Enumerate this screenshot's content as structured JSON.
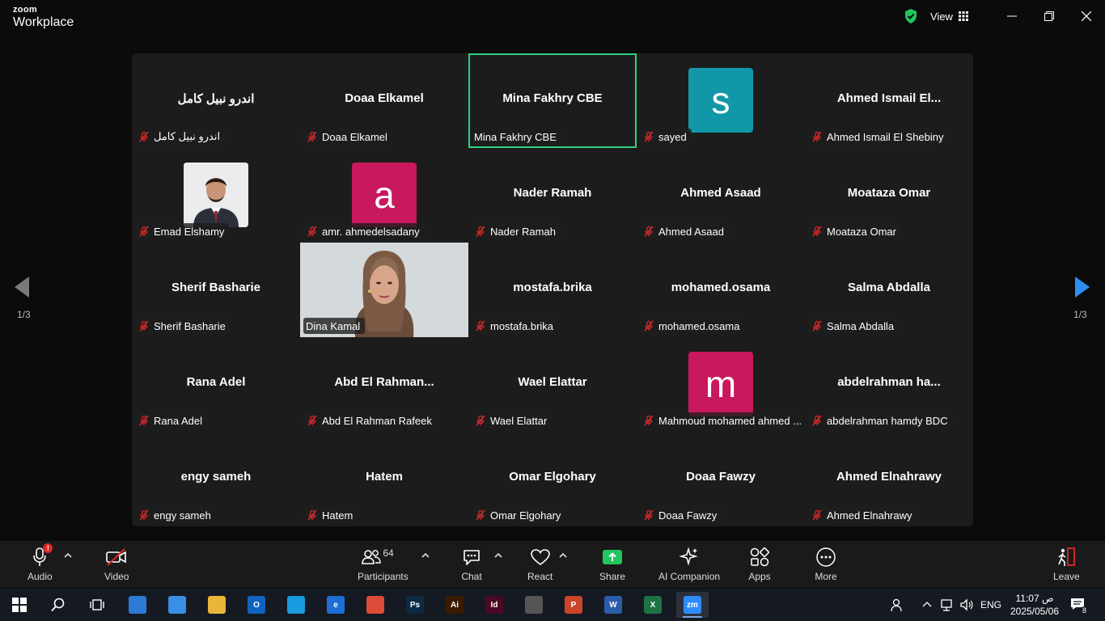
{
  "window": {
    "brand_small": "zoom",
    "brand_big": "Workplace",
    "view_label": "View"
  },
  "navigation": {
    "left_page": "1/3",
    "right_page": "1/3"
  },
  "tiles": [
    {
      "big": "اندرو نبيل كامل",
      "label": "اندرو نبيل كامل",
      "muted": true
    },
    {
      "big": "Doaa Elkamel",
      "label": "Doaa Elkamel",
      "muted": true
    },
    {
      "big": "Mina Fakhry CBE",
      "label": "Mina Fakhry CBE",
      "muted": false,
      "active": true
    },
    {
      "avatar": "s",
      "avatar_color": "#1197a7",
      "label": "sayed",
      "muted": true
    },
    {
      "big": "Ahmed Ismail El...",
      "label": "Ahmed Ismail El Shebiny",
      "muted": true
    },
    {
      "photo": "portrait",
      "label": "Emad Elshamy",
      "muted": true
    },
    {
      "avatar": "a",
      "avatar_color": "#c8185e",
      "label": "amr. ahmedelsadany",
      "muted": true
    },
    {
      "big": "Nader Ramah",
      "label": "Nader Ramah",
      "muted": true
    },
    {
      "big": "Ahmed Asaad",
      "label": "Ahmed Asaad",
      "muted": true
    },
    {
      "big": "Moataza Omar",
      "label": "Moataza Omar",
      "muted": true
    },
    {
      "big": "Sherif Basharie",
      "label": "Sherif Basharie",
      "muted": true
    },
    {
      "video": true,
      "label": "Dina Kamal",
      "muted": false
    },
    {
      "big": "mostafa.brika",
      "label": "mostafa.brika",
      "muted": true
    },
    {
      "big": "mohamed.osama",
      "label": "mohamed.osama",
      "muted": true
    },
    {
      "big": "Salma Abdalla",
      "label": "Salma Abdalla",
      "muted": true
    },
    {
      "big": "Rana Adel",
      "label": "Rana Adel",
      "muted": true
    },
    {
      "big": "Abd El Rahman...",
      "label": "Abd El Rahman Rafeek",
      "muted": true
    },
    {
      "big": "Wael Elattar",
      "label": "Wael Elattar",
      "muted": true
    },
    {
      "avatar": "m",
      "avatar_color": "#c8185e",
      "label": "Mahmoud mohamed ahmed ...",
      "muted": true
    },
    {
      "big": "abdelrahman  ha...",
      "label": "abdelrahman hamdy BDC",
      "muted": true
    },
    {
      "big": "engy sameh",
      "label": "engy sameh",
      "muted": true
    },
    {
      "big": "Hatem",
      "label": "Hatem",
      "muted": true
    },
    {
      "big": "Omar Elgohary",
      "label": "Omar Elgohary",
      "muted": true
    },
    {
      "big": "Doaa Fawzy",
      "label": "Doaa Fawzy",
      "muted": true
    },
    {
      "big": "Ahmed Elnahrawy",
      "label": "Ahmed Elnahrawy",
      "muted": true
    }
  ],
  "toolbar": {
    "audio": "Audio",
    "audio_badge": "!",
    "video": "Video",
    "participants": "Participants",
    "participants_count": "64",
    "chat": "Chat",
    "react": "React",
    "share": "Share",
    "ai_companion": "AI Companion",
    "apps": "Apps",
    "more": "More",
    "leave": "Leave"
  },
  "taskbar": {
    "language": "ENG",
    "time": "11:07 ص",
    "date": "2025/05/06",
    "notification_count": "8",
    "apps": [
      {
        "name": "store",
        "glyph": "",
        "color": "#2e7bd6"
      },
      {
        "name": "screen",
        "glyph": "",
        "color": "#3a8ee6"
      },
      {
        "name": "explorer",
        "glyph": "",
        "color": "#e8b73a"
      },
      {
        "name": "outlook",
        "glyph": "O",
        "color": "#0f64c2"
      },
      {
        "name": "edge",
        "glyph": "",
        "color": "#1a9be0"
      },
      {
        "name": "ie",
        "glyph": "e",
        "color": "#1d6fd6"
      },
      {
        "name": "chrome",
        "glyph": "",
        "color": "#dd4b39"
      },
      {
        "name": "photoshop",
        "glyph": "Ps",
        "color": "#0d2a45"
      },
      {
        "name": "illustrator",
        "glyph": "Ai",
        "color": "#3a1a00"
      },
      {
        "name": "indesign",
        "glyph": "Id",
        "color": "#4a0822"
      },
      {
        "name": "calculator",
        "glyph": "",
        "color": "#555"
      },
      {
        "name": "powerpoint",
        "glyph": "P",
        "color": "#c9462b"
      },
      {
        "name": "word",
        "glyph": "W",
        "color": "#2b5cab"
      },
      {
        "name": "excel",
        "glyph": "X",
        "color": "#1f7244"
      },
      {
        "name": "zoom",
        "glyph": "zm",
        "color": "#2d8cff"
      }
    ]
  }
}
